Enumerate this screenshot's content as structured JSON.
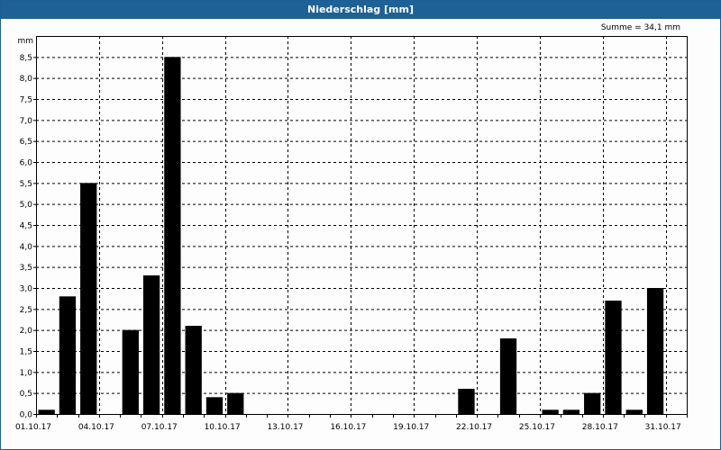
{
  "window": {
    "title": "Niederschlag [mm]",
    "sum_label": "Summe = 34,1 mm"
  },
  "chart_data": {
    "type": "bar",
    "title": "Niederschlag [mm]",
    "ylabel": "mm",
    "ylim": [
      0,
      9
    ],
    "yticks": [
      "0,0",
      "0,5",
      "1,0",
      "1,5",
      "2,0",
      "2,5",
      "3,0",
      "3,5",
      "4,0",
      "4,5",
      "5,0",
      "5,5",
      "6,0",
      "6,5",
      "7,0",
      "7,5",
      "8,0",
      "8,5"
    ],
    "xtick_labels": [
      "01.10.17",
      "04.10.17",
      "07.10.17",
      "10.10.17",
      "13.10.17",
      "16.10.17",
      "19.10.17",
      "22.10.17",
      "25.10.17",
      "28.10.17",
      "31.10.17"
    ],
    "categories": [
      "01.10",
      "02.10",
      "03.10",
      "04.10",
      "05.10",
      "06.10",
      "07.10",
      "08.10",
      "09.10",
      "10.10",
      "11.10",
      "12.10",
      "13.10",
      "14.10",
      "15.10",
      "16.10",
      "17.10",
      "18.10",
      "19.10",
      "20.10",
      "21.10",
      "22.10",
      "23.10",
      "24.10",
      "25.10",
      "26.10",
      "27.10",
      "28.10",
      "29.10",
      "30.10",
      "31.10"
    ],
    "values": [
      0.1,
      2.8,
      5.5,
      0,
      2.0,
      3.3,
      8.5,
      2.1,
      0.4,
      0.5,
      0,
      0,
      0,
      0,
      0,
      0,
      0,
      0,
      0,
      0,
      0.6,
      0,
      1.8,
      0,
      0.1,
      0.1,
      0.5,
      2.7,
      0.1,
      3.0,
      0
    ],
    "grid": true,
    "bar_color": "#000000",
    "sum": "Summe = 34,1 mm"
  }
}
